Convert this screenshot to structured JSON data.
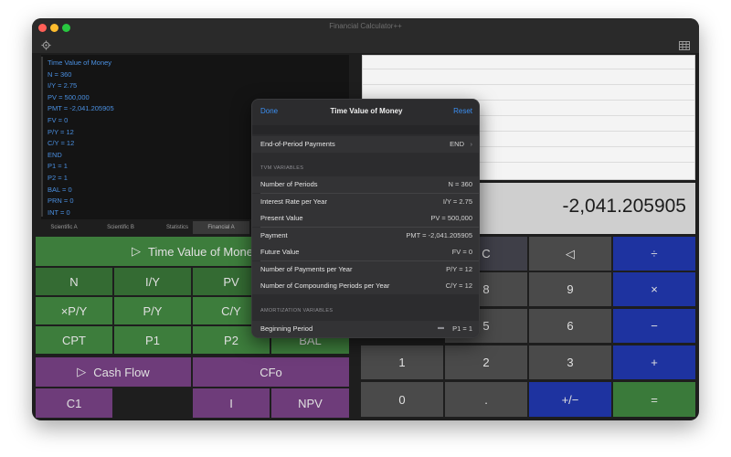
{
  "window": {
    "title": "Financial Calculator++"
  },
  "tape": {
    "lines": [
      "Time Value of Money",
      "N = 360",
      "I/Y = 2.75",
      "PV = 500,000",
      "PMT = -2,041.205905",
      "FV = 0",
      "P/Y = 12",
      "C/Y = 12",
      "END",
      "P1 = 1",
      "P2 = 1",
      "BAL = 0",
      "PRN = 0",
      "INT = 0"
    ]
  },
  "tabs": [
    "Scientific A",
    "Scientific B",
    "Statistics",
    "Financial A"
  ],
  "display": {
    "value": "-2,041.205905"
  },
  "keypad_left": {
    "tvm_label": "Time Value of Mone",
    "tvm_arrow": "▷",
    "row1": [
      "N",
      "I/Y",
      "PV"
    ],
    "row2": [
      "×P/Y",
      "P/Y",
      "C/Y"
    ],
    "row3": [
      "CPT",
      "P1",
      "P2",
      "BAL"
    ],
    "cashflow_label": "Cash Flow",
    "cashflow_arrow": "▷",
    "cfo_label": "CFo",
    "row5": [
      "C1",
      "I",
      "NPV"
    ]
  },
  "keypad_right": {
    "row1": [
      "C",
      "◁",
      "÷"
    ],
    "row2": [
      "8",
      "9",
      "×"
    ],
    "row3": [
      "5",
      "6",
      "−"
    ],
    "row4": [
      "1",
      "2",
      "3",
      "+"
    ],
    "row5": [
      "0",
      ".",
      "+/−",
      "="
    ]
  },
  "sheet": {
    "done_label": "Done",
    "title": "Time Value of Money",
    "reset_label": "Reset",
    "payment_timing": {
      "label": "End-of-Period Payments",
      "value": "END",
      "chevron": "›"
    },
    "tvm_header": "TVM VARIABLES",
    "tvm_rows": [
      {
        "label": "Number of Periods",
        "value": "N = 360"
      },
      {
        "label": "Interest Rate per Year",
        "value": "I/Y = 2.75"
      },
      {
        "label": "Present Value",
        "value": "PV = 500,000"
      },
      {
        "label": "Payment",
        "value": "PMT = -2,041.205905"
      },
      {
        "label": "Future Value",
        "value": "FV = 0"
      },
      {
        "label": "Number of Payments per Year",
        "value": "P/Y = 12"
      },
      {
        "label": "Number of Compounding Periods per Year",
        "value": "C/Y = 12"
      }
    ],
    "amort_header": "AMORTIZATION VARIABLES",
    "amort_rows": [
      {
        "label": "Beginning Period",
        "value": "P1 = 1"
      }
    ]
  }
}
